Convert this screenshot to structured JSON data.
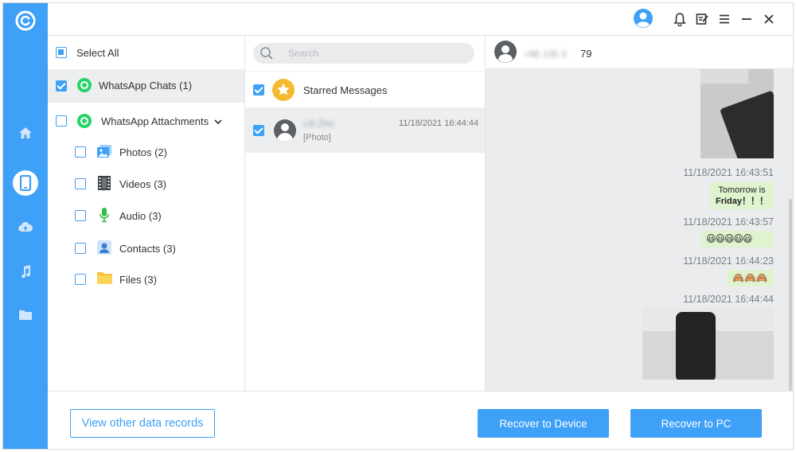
{
  "header": {
    "account_icon": "user-circle-icon",
    "bell_icon": "bell-icon",
    "feedback_icon": "edit-note-icon",
    "menu_icon": "menu-icon",
    "minimize_icon": "minimize-icon",
    "close_icon": "close-icon"
  },
  "rail": {
    "items": [
      "home-icon",
      "phone-icon",
      "cloud-icon",
      "music-icon",
      "folder-icon"
    ],
    "active": "phone-icon",
    "accent": "#3ea0f7"
  },
  "categories": {
    "select_all": "Select All",
    "items": [
      {
        "label": "WhatsApp Chats (1)",
        "checked": true
      },
      {
        "label": "WhatsApp Attachments",
        "checked": false
      },
      {
        "label": "Photos (2)",
        "checked": false
      },
      {
        "label": "Videos (3)",
        "checked": false
      },
      {
        "label": "Audio (3)",
        "checked": false
      },
      {
        "label": "Contacts (3)",
        "checked": false
      },
      {
        "label": "Files (3)",
        "checked": false
      }
    ]
  },
  "chats": {
    "search_placeholder": "Search",
    "starred_label": "Starred Messages",
    "chat": {
      "name": "Lili Zhu",
      "time": "11/18/2021 16:44:44",
      "preview": "[Photo]"
    }
  },
  "conversation": {
    "contact_hidden": "+86 135 3",
    "contact_suffix": "79",
    "messages": [
      {
        "time": "11/18/2021 16:43:51",
        "text": "Tomorrow is Friday！！！"
      },
      {
        "time": "11/18/2021 16:43:57",
        "text": "😃😃😃😃😃"
      },
      {
        "time": "11/18/2021 16:44:23",
        "text": "🙈🙈🙈"
      },
      {
        "time": "11/18/2021 16:44:44",
        "text": ""
      }
    ],
    "bubble_line1": "Tomorrow is",
    "bubble_line2": "Friday！！！"
  },
  "footer": {
    "view_other": "View other data records",
    "recover_device": "Recover to Device",
    "recover_pc": "Recover to PC"
  }
}
